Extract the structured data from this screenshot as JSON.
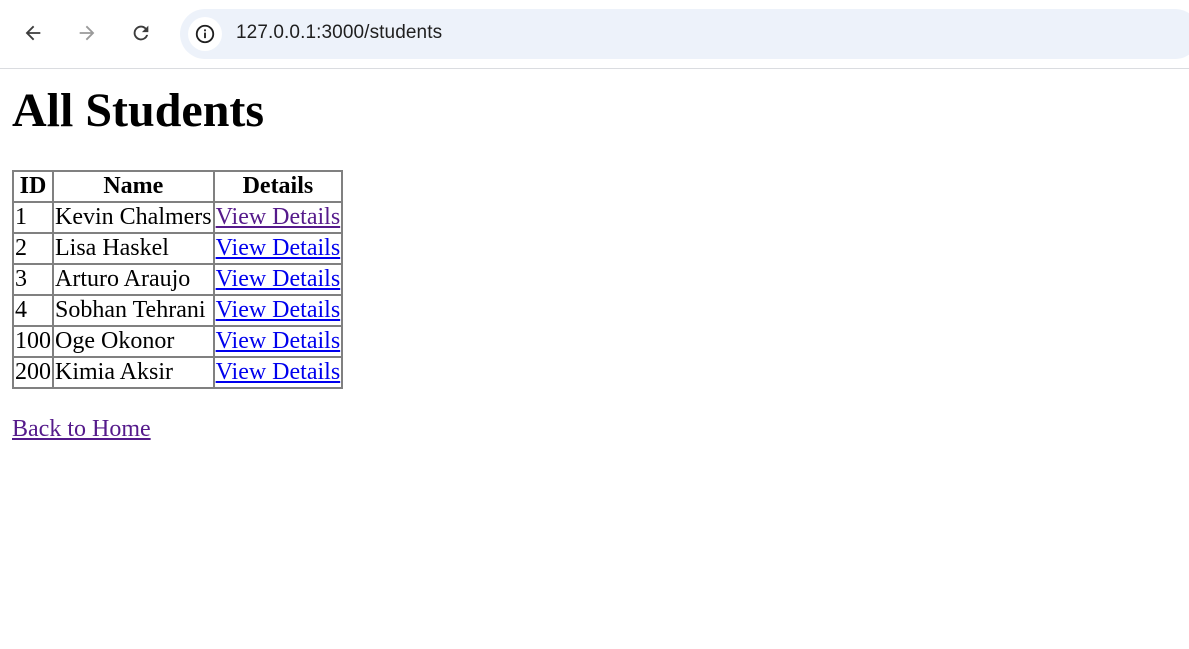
{
  "browser": {
    "url": "127.0.0.1:3000/students",
    "icons": {
      "back": "arrow-left-icon",
      "forward": "arrow-right-icon",
      "reload": "reload-icon",
      "site_info": "info-icon"
    }
  },
  "page": {
    "title": "All Students",
    "table": {
      "headers": [
        "ID",
        "Name",
        "Details"
      ],
      "rows": [
        {
          "id": "1",
          "name": "Kevin Chalmers",
          "details": "View Details",
          "visited": true
        },
        {
          "id": "2",
          "name": "Lisa Haskel",
          "details": "View Details",
          "visited": false
        },
        {
          "id": "3",
          "name": "Arturo Araujo",
          "details": "View Details",
          "visited": false
        },
        {
          "id": "4",
          "name": "Sobhan Tehrani",
          "details": "View Details",
          "visited": false
        },
        {
          "id": "100",
          "name": "Oge Okonor",
          "details": "View Details",
          "visited": false
        },
        {
          "id": "200",
          "name": "Kimia Aksir",
          "details": "View Details",
          "visited": false
        }
      ]
    },
    "home_link": "Back to Home"
  },
  "colors": {
    "link": "#0000ee",
    "visited_link": "#551a8b",
    "omnibox_bg": "#edf2fa"
  }
}
